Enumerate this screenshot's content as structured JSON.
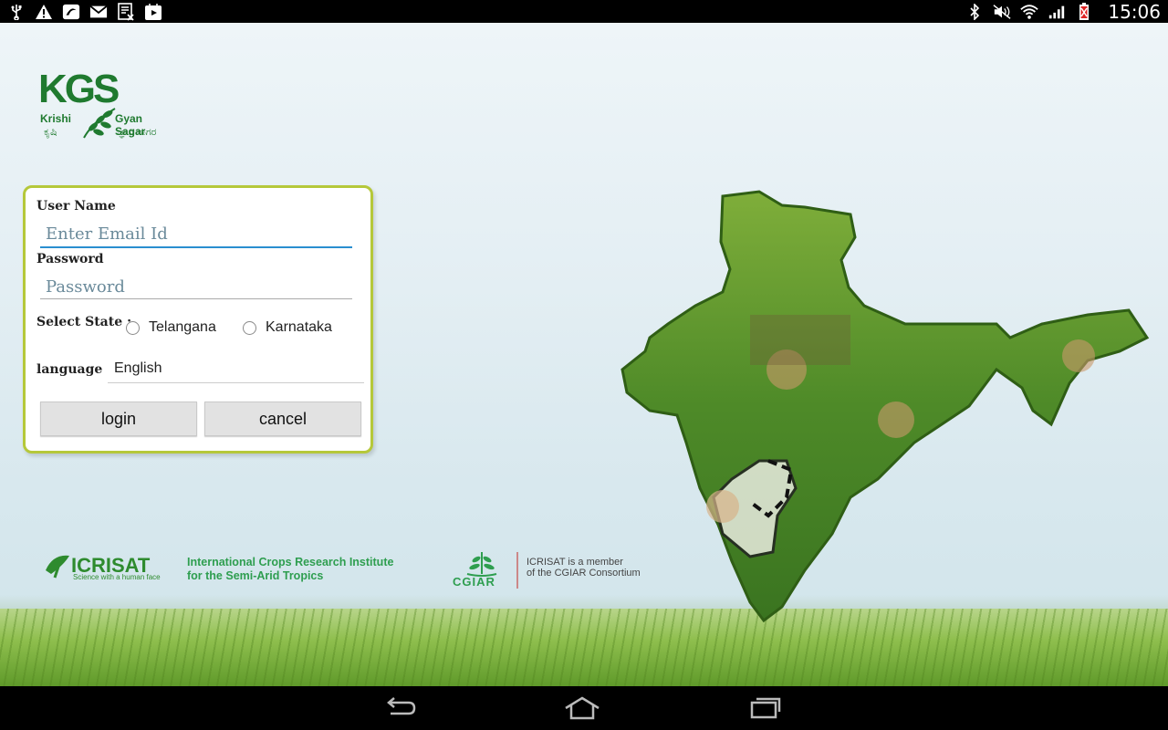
{
  "status_bar": {
    "left_icons": [
      "usb-icon",
      "warning-icon",
      "app-icon",
      "mail-icon",
      "screenshot-icon",
      "play-store-icon"
    ],
    "right_icons": [
      "bluetooth-icon",
      "mute-icon",
      "wifi-icon",
      "signal-icon",
      "battery-icon"
    ],
    "time": "15:06"
  },
  "logo": {
    "initials": "KGS",
    "left_word": "Krishi",
    "right_word": "Gyan Sagar",
    "left_kannada": "ಕೃಷಿ",
    "right_kannada": "ಜ್ಞಾನ ಸಾಗರ"
  },
  "login_form": {
    "username_label": "User Name",
    "username_placeholder": "Enter Email Id",
    "username_value": "",
    "password_label": "Password",
    "password_placeholder": "Password",
    "password_value": "",
    "state_label": "Select State :",
    "states": [
      "Telangana",
      "Karnataka"
    ],
    "language_label": "language",
    "language_value": "English",
    "login_button": "login",
    "cancel_button": "cancel"
  },
  "sponsors": {
    "icrisat_name": "ICRISAT",
    "icrisat_tagline": "Science with a human face",
    "icrisat_full_line1": "International Crops Research Institute",
    "icrisat_full_line2": "for the Semi-Arid Tropics",
    "cgiar_name": "CGIAR",
    "cgiar_member_line1": "ICRISAT is a member",
    "cgiar_member_line2": "of the CGIAR Consortium"
  },
  "nav_bar": {
    "buttons": [
      "back-icon",
      "home-icon",
      "recent-apps-icon"
    ]
  },
  "colors": {
    "card_border": "#b5c83a",
    "brand_green": "#1f7a2f",
    "input_focus": "#2a8fd0"
  }
}
